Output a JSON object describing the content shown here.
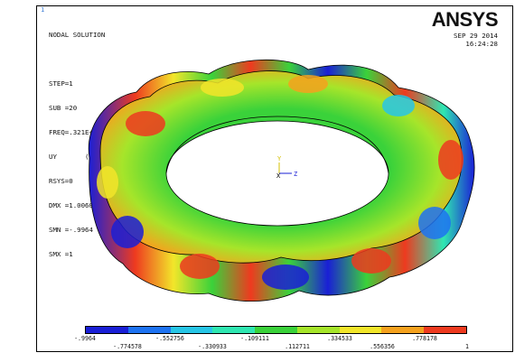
{
  "window_number": "1",
  "info_lines": [
    "NODAL SOLUTION",
    "",
    "STEP=1",
    "SUB =20",
    "FREQ=.321E+08",
    "UY       (AVG)",
    "RSYS=0",
    "DMX =1.00603",
    "SMN =-.9964",
    "SMX =1"
  ],
  "logo": "ANSYS",
  "date": "SEP 29 2014",
  "time": "16:24:28",
  "triad": {
    "y": "Y",
    "x": "X",
    "z": "Z"
  },
  "colorbar": {
    "colors": [
      "#1a1fd6",
      "#1e73f2",
      "#27c6e6",
      "#2fe7b2",
      "#3ad23a",
      "#a6e52a",
      "#f2e62a",
      "#f5a21e",
      "#ee3a1f"
    ],
    "labels_top": [
      "-.9964",
      "-.552756",
      "-.109111",
      ".334533",
      ".778178"
    ],
    "labels_bottom": [
      "-.774578",
      "-.330933",
      ".112711",
      ".556356",
      "1"
    ]
  }
}
